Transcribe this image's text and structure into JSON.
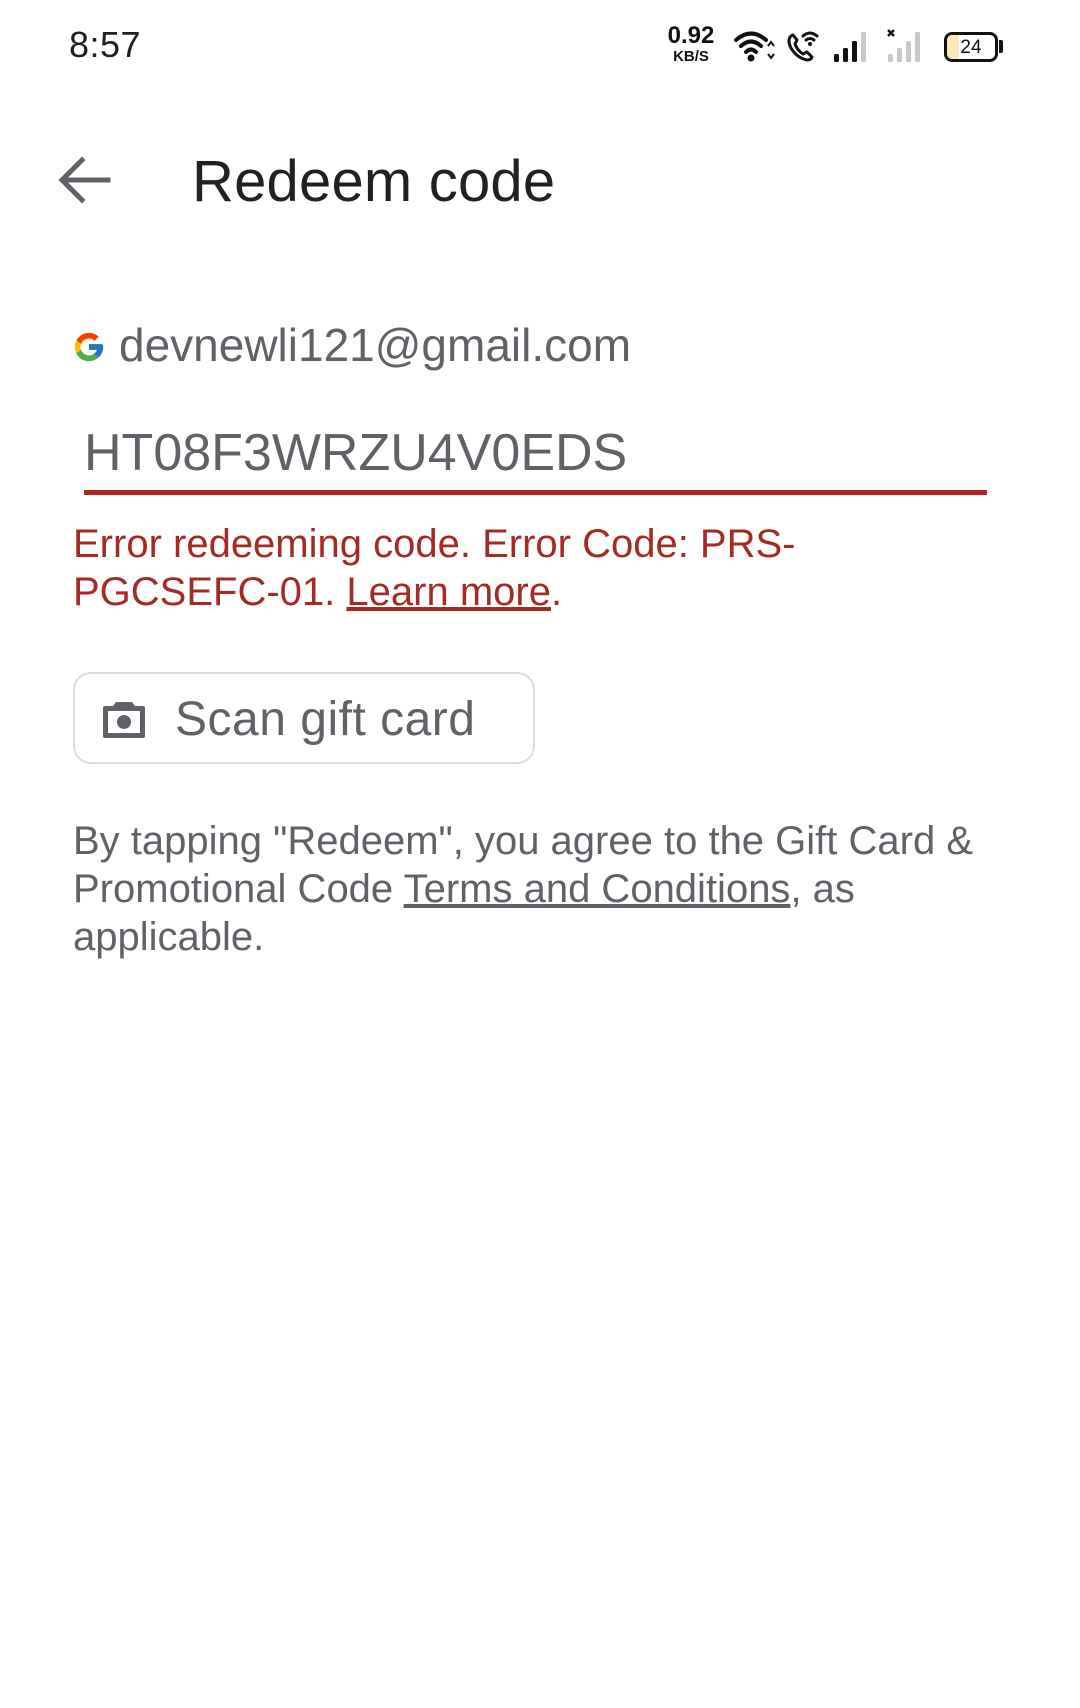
{
  "status_bar": {
    "time": "8:57",
    "net_speed_value": "0.92",
    "net_speed_unit": "KB/S",
    "icons": [
      "wifi-icon",
      "wifi-calling-icon",
      "signal-sim1-icon",
      "signal-sim2-no-service-icon",
      "battery-icon"
    ],
    "battery_level": "24",
    "battery_fraction": 0.24
  },
  "header": {
    "back_icon": "arrow-back-icon",
    "title": "Redeem code"
  },
  "account": {
    "icon": "google-g-icon",
    "email": "devnewli121@gmail.com"
  },
  "code_field": {
    "value": "HT08F3WRZU4V0EDS",
    "state": "error",
    "accent_color": "#b3261e"
  },
  "error": {
    "message": "Error redeeming code. Error Code: PRS-PGCSEFC-01.",
    "link_label": "Learn more",
    "trailing": ".",
    "color": "#a52a24"
  },
  "scan_button": {
    "icon": "camera-icon",
    "label": "Scan gift card"
  },
  "terms": {
    "text_before": "By tapping \"Redeem\", you agree to the Gift Card & Promotional Code ",
    "link_label": "Terms and Conditions",
    "text_after": ", as applicable."
  }
}
